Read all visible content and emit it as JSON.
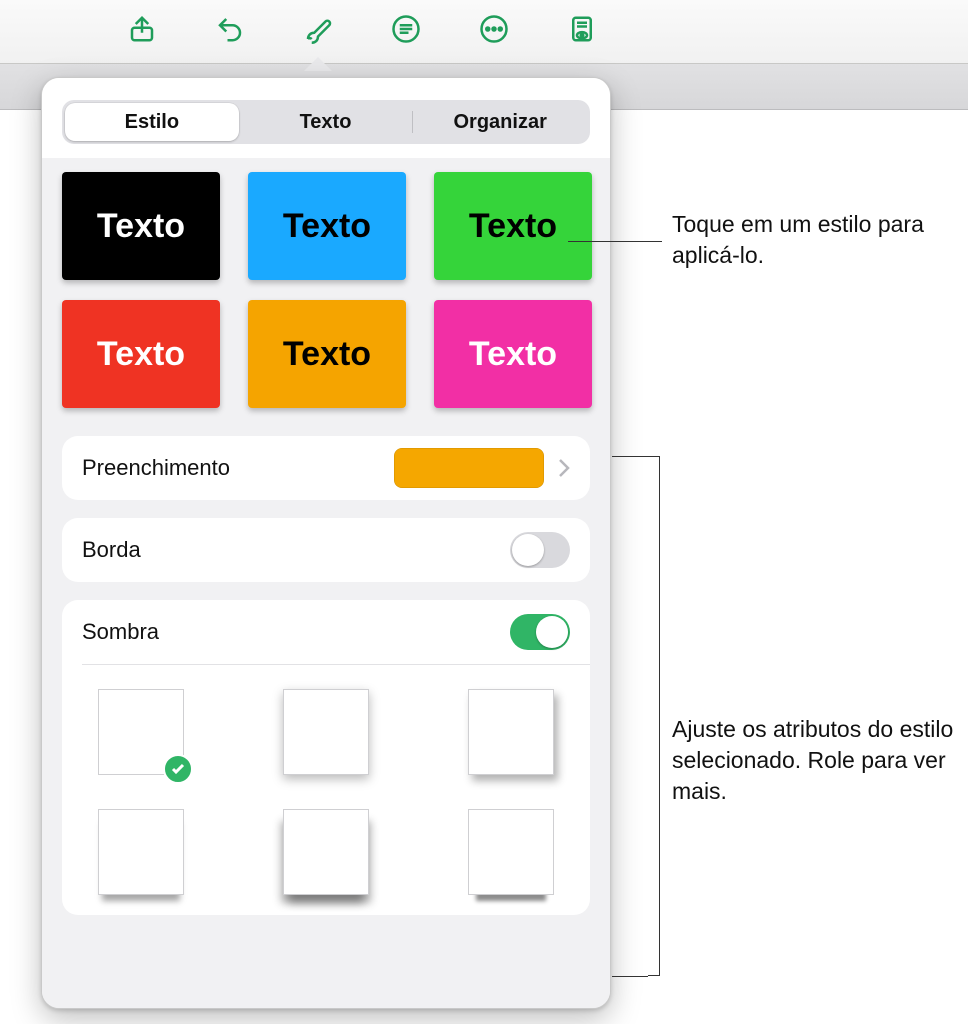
{
  "toolbar": {
    "share": "share",
    "undo": "undo",
    "format": "format-brush",
    "summary": "summary",
    "more": "more",
    "notes": "presenter-notes"
  },
  "segmented": {
    "style": "Estilo",
    "text": "Texto",
    "arrange": "Organizar"
  },
  "styles": {
    "thumb_label": "Texto",
    "items": [
      {
        "bg": "#000000",
        "fg": "#ffffff"
      },
      {
        "bg": "#1aa9ff",
        "fg": "#000000"
      },
      {
        "bg": "#35d43a",
        "fg": "#000000"
      },
      {
        "bg": "#ef3323",
        "fg": "#ffffff"
      },
      {
        "bg": "#f5a400",
        "fg": "#000000"
      },
      {
        "bg": "#f22fa5",
        "fg": "#ffffff"
      }
    ]
  },
  "options": {
    "fill_label": "Preenchimento",
    "fill_color": "#f5a700",
    "border_label": "Borda",
    "border_on": false,
    "shadow_label": "Sombra",
    "shadow_on": true
  },
  "callouts": {
    "apply_style": "Toque em um estilo para aplicá-lo.",
    "adjust_attrs": "Ajuste os atributos do estilo selecionado. Role para ver mais."
  }
}
